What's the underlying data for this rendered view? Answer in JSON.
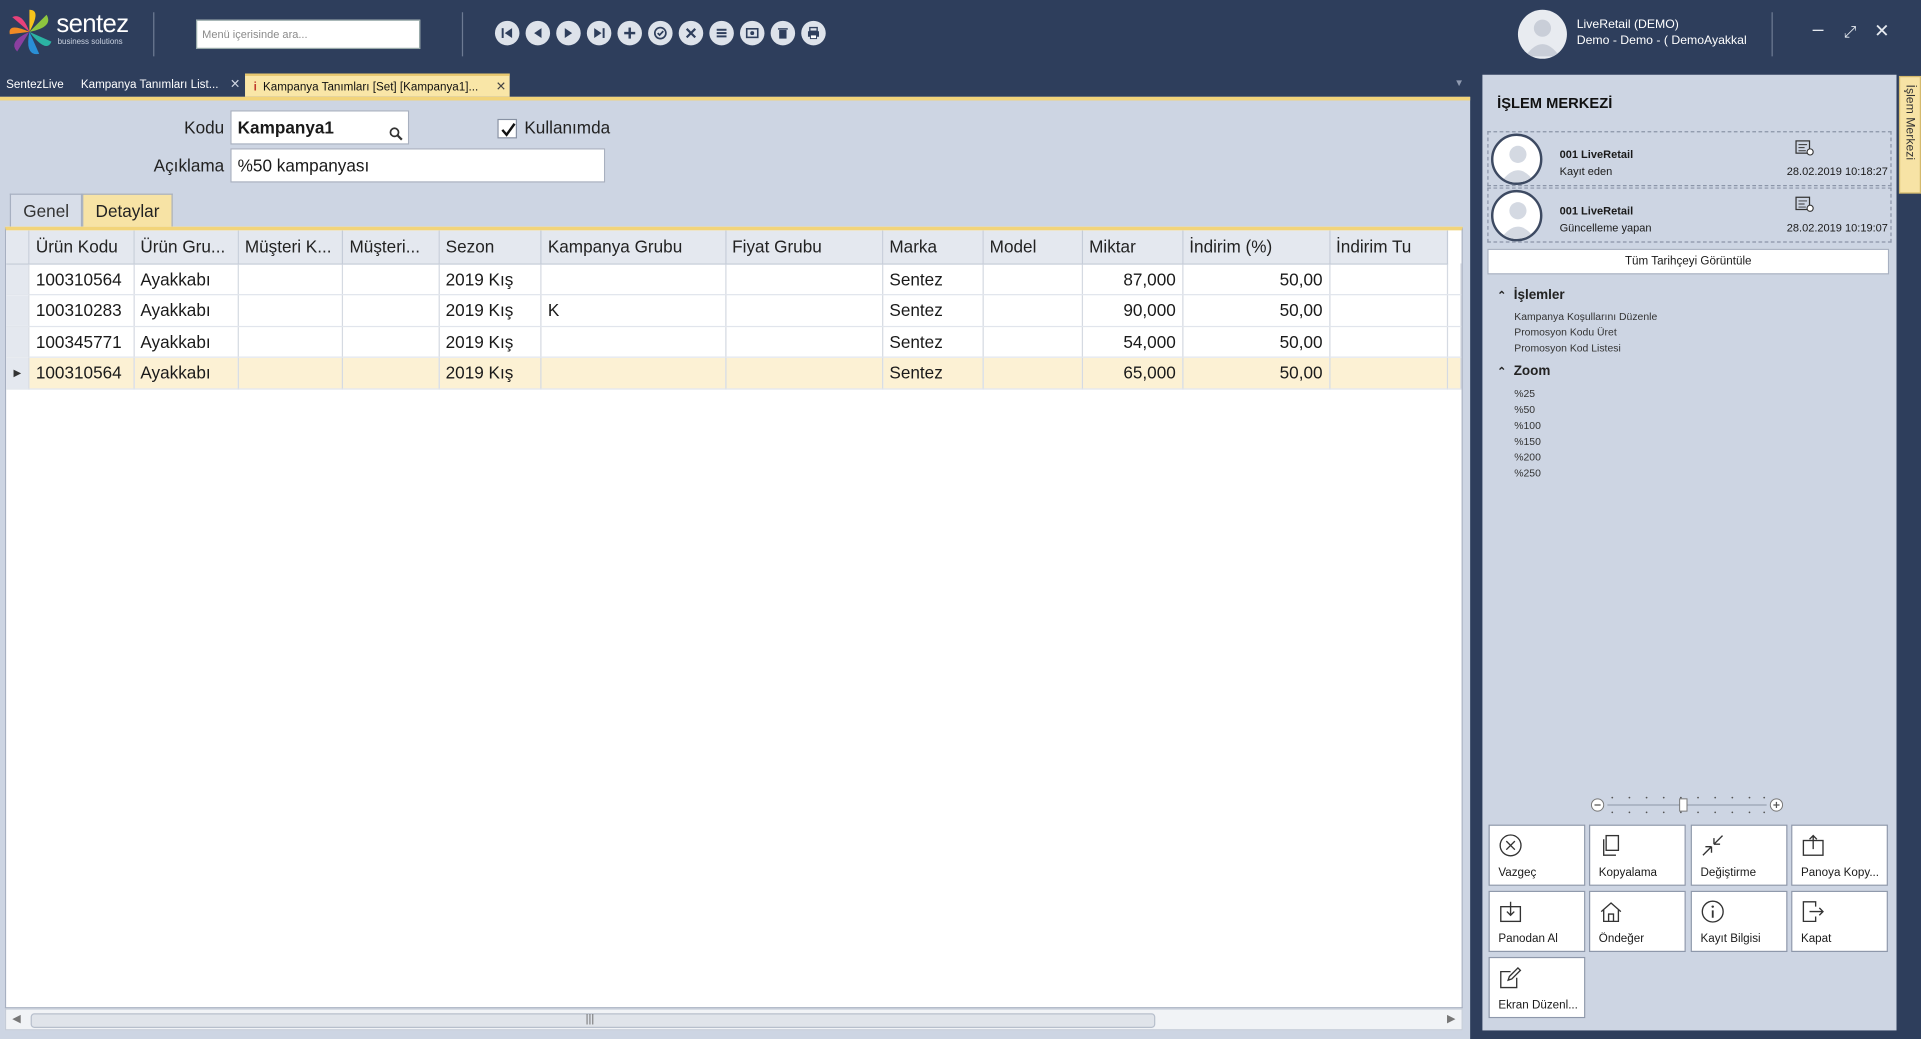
{
  "app": {
    "logo_text": "sentez",
    "logo_sub": "business solutions",
    "menu_search_placeholder": "Menü içerisinde ara...",
    "user_name": "LiveRetail (DEMO)",
    "user_detail": "Demo - Demo - ( DemoAyakkal",
    "nav_icons": [
      "first-record-icon",
      "previous-record-icon",
      "next-record-icon",
      "last-record-icon",
      "add-icon",
      "save-icon",
      "cancel-icon",
      "list-icon",
      "preview-icon",
      "delete-icon",
      "print-icon"
    ]
  },
  "doc_tabs": [
    {
      "label": "SentezLive"
    },
    {
      "label": "Kampanya Tanımları List..."
    },
    {
      "label": "Kampanya Tanımları  [Set] [Kampanya1]..."
    }
  ],
  "form": {
    "kodu_label": "Kodu",
    "kodu_value": "Kampanya1",
    "kullanimda_label": "Kullanımda",
    "kullanimda_checked": true,
    "aciklama_label": "Açıklama",
    "aciklama_value": "%50 kampanyası",
    "tabs": [
      "Genel",
      "Detaylar"
    ],
    "active_tab": "Detaylar"
  },
  "grid": {
    "columns": [
      "Ürün Kodu",
      "Ürün Gru...",
      "Müşteri K...",
      "Müşteri...",
      "Sezon",
      "Kampanya Grubu",
      "Fiyat Grubu",
      "Marka",
      "Model",
      "Miktar",
      "İndirim (%)",
      "İndirim Tu"
    ],
    "rows": [
      [
        "100310564",
        "Ayakkabı",
        "",
        "",
        "2019 Kış",
        "",
        "",
        "Sentez",
        "",
        "87,000",
        "50,00",
        ""
      ],
      [
        "100310283",
        "Ayakkabı",
        "",
        "",
        "2019 Kış",
        "K",
        "",
        "Sentez",
        "",
        "90,000",
        "50,00",
        ""
      ],
      [
        "100345771",
        "Ayakkabı",
        "",
        "",
        "2019 Kış",
        "",
        "",
        "Sentez",
        "",
        "54,000",
        "50,00",
        ""
      ],
      [
        "100310564",
        "Ayakkabı",
        "",
        "",
        "2019 Kış",
        "",
        "",
        "Sentez",
        "",
        "65,000",
        "50,00",
        ""
      ]
    ],
    "selected_row": 3
  },
  "panel": {
    "title": "İŞLEM MERKEZİ",
    "history": [
      {
        "name": "001 LiveRetail",
        "role": "Kayıt eden",
        "date": "28.02.2019 10:18:27"
      },
      {
        "name": "001 LiveRetail",
        "role": "Güncelleme yapan",
        "date": "28.02.2019 10:19:07"
      }
    ],
    "history_button": "Tüm Tarihçeyi Görüntüle",
    "islemler_title": "İşlemler",
    "islemler_items": [
      "Kampanya Koşullarını Düzenle",
      "Promosyon Kodu Üret",
      "Promosyon Kod Listesi"
    ],
    "zoom_title": "Zoom",
    "zoom_items": [
      "%25",
      "%50",
      "%100",
      "%150",
      "%200",
      "%250"
    ],
    "actions": [
      {
        "label": "Vazgeç",
        "icon": "cancel-circle-icon"
      },
      {
        "label": "Kopyalama",
        "icon": "copy-icon"
      },
      {
        "label": "Değiştirme",
        "icon": "shrink-icon"
      },
      {
        "label": "Panoya Kopy...",
        "icon": "clipboard-up-icon"
      },
      {
        "label": "Panodan Al",
        "icon": "clipboard-down-icon"
      },
      {
        "label": "Öndeğer",
        "icon": "home-icon"
      },
      {
        "label": "Kayıt Bilgisi",
        "icon": "info-icon"
      },
      {
        "label": "Kapat",
        "icon": "exit-icon"
      },
      {
        "label": "Ekran Düzenl...",
        "icon": "edit-icon"
      }
    ],
    "side_tab": "İşlem Merkezi"
  }
}
